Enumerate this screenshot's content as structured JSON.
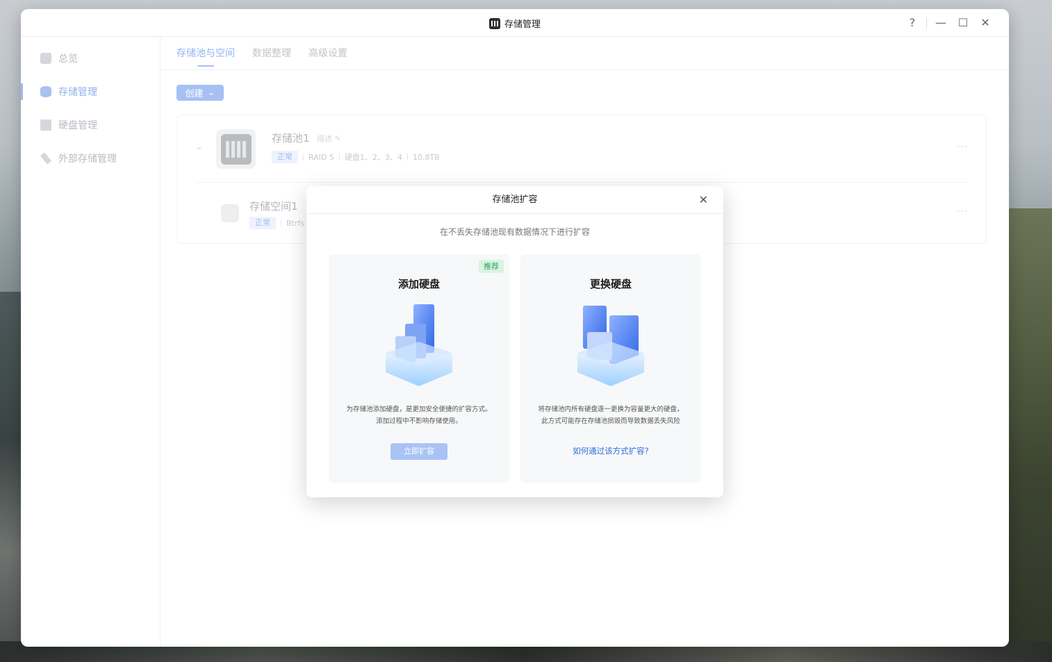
{
  "window": {
    "title": "存储管理",
    "controls": {
      "help": "?",
      "minimize": "—",
      "maximize": "☐",
      "close": "✕"
    }
  },
  "sidebar": {
    "items": [
      {
        "label": "总览",
        "icon": "overview-icon",
        "active": false
      },
      {
        "label": "存储管理",
        "icon": "database-icon",
        "active": true
      },
      {
        "label": "硬盘管理",
        "icon": "disk-icon",
        "active": false
      },
      {
        "label": "外部存储管理",
        "icon": "external-storage-icon",
        "active": false
      }
    ]
  },
  "tabs": [
    {
      "label": "存储池与空间",
      "active": true
    },
    {
      "label": "数据整理",
      "active": false
    },
    {
      "label": "高级设置",
      "active": false
    }
  ],
  "toolbar": {
    "create_label": "创建"
  },
  "pool": {
    "name": "存储池1",
    "desc_placeholder": "描述",
    "status": "正常",
    "raid": "RAID 5",
    "disks": "硬盘1、2、3、4",
    "capacity": "10.8TB",
    "more": "···"
  },
  "space": {
    "name": "存储空间1",
    "status": "正常",
    "fs": "Btrfs",
    "more": "···"
  },
  "modal": {
    "title": "存储池扩容",
    "subtitle": "在不丢失存储池现有数据情况下进行扩容",
    "close": "✕",
    "options": [
      {
        "badge": "推荐",
        "title": "添加硬盘",
        "text_line1": "为存储池添加硬盘，是更加安全便捷的扩容方式。",
        "text_line2": "添加过程中不影响存储使用。",
        "action": "立即扩容"
      },
      {
        "title": "更换硬盘",
        "text_line1": "将存储池内所有硬盘逐一更换为容量更大的硬盘，",
        "text_line2": "此方式可能存在存储池损毁而导致数据丢失风险",
        "link": "如何通过该方式扩容?"
      }
    ]
  },
  "colors": {
    "accent": "#3370ff",
    "accent_disabled": "#a9c3f4",
    "recommend_bg": "#d9f4e2",
    "recommend_text": "#2fa35a"
  }
}
